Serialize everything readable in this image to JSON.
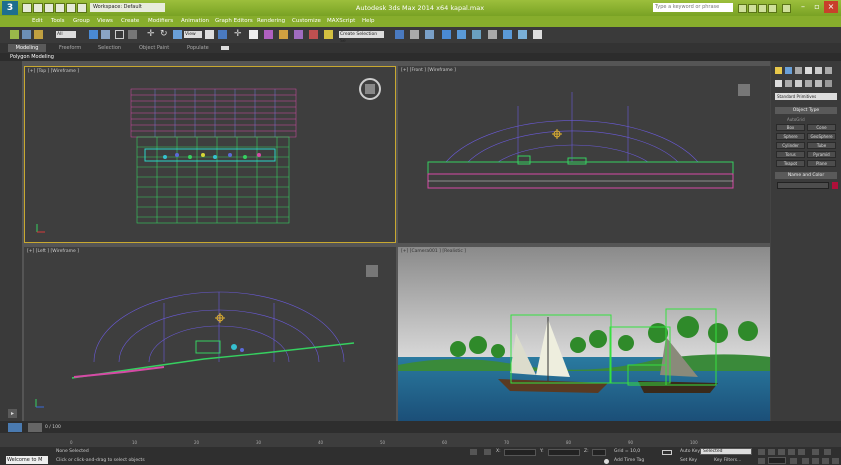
{
  "titlebar": {
    "workspace": "Workspace: Default",
    "title": "Autodesk 3ds Max  2014 x64     kapal.max",
    "help_search_placeholder": "Type a keyword or phrase"
  },
  "menu": [
    "Edit",
    "Tools",
    "Group",
    "Views",
    "Create",
    "Modifiers",
    "Animation",
    "Graph Editors",
    "Rendering",
    "Customize",
    "MAXScript",
    "Help"
  ],
  "toolbar": {
    "selection_filter": "All",
    "ref_coord": "View",
    "named_selection": "Create Selection Se"
  },
  "ribbon": {
    "tabs": [
      "Modeling",
      "Freeform",
      "Selection",
      "Object Paint",
      "Populate"
    ],
    "panel": "Polygon Modeling"
  },
  "viewports": {
    "top": "[+] [Top ] [Wireframe ]",
    "front": "[+] [Front ] [Wireframe ]",
    "left": "[+] [Left ] [Wireframe ]",
    "camera": "[+] [Camera001 ] [Realistic ]"
  },
  "command_panel": {
    "category": "Standard Primitives",
    "object_type_header": "Object Type",
    "autogrid": "AutoGrid",
    "buttons": [
      "Box",
      "Cone",
      "Sphere",
      "GeoSphere",
      "Cylinder",
      "Tube",
      "Torus",
      "Pyramid",
      "Teapot",
      "Plane"
    ],
    "name_color_header": "Name and Color"
  },
  "timeline": {
    "frame": "0 / 100",
    "ticks": [
      "0",
      "10",
      "20",
      "30",
      "40",
      "50",
      "60",
      "70",
      "80",
      "90",
      "100"
    ]
  },
  "status": {
    "listener": "Welcome to M",
    "selection": "None Selected",
    "prompt": "Click or click-and-drag to select objects",
    "grid": "Grid = 10,0",
    "add_time_tag": "Add Time Tag",
    "auto_key": "Auto Key",
    "key_filter_value": "Selected",
    "set_key": "Set Key",
    "key_filters": "Key Filters...",
    "x_label": "X:",
    "y_label": "Y:",
    "z_label": "Z:"
  },
  "colors": {
    "titlebar": "#8bb232",
    "viewport_bg": "#3e3e3e",
    "active_border": "#c8a830",
    "object_color": "#b0103a"
  }
}
